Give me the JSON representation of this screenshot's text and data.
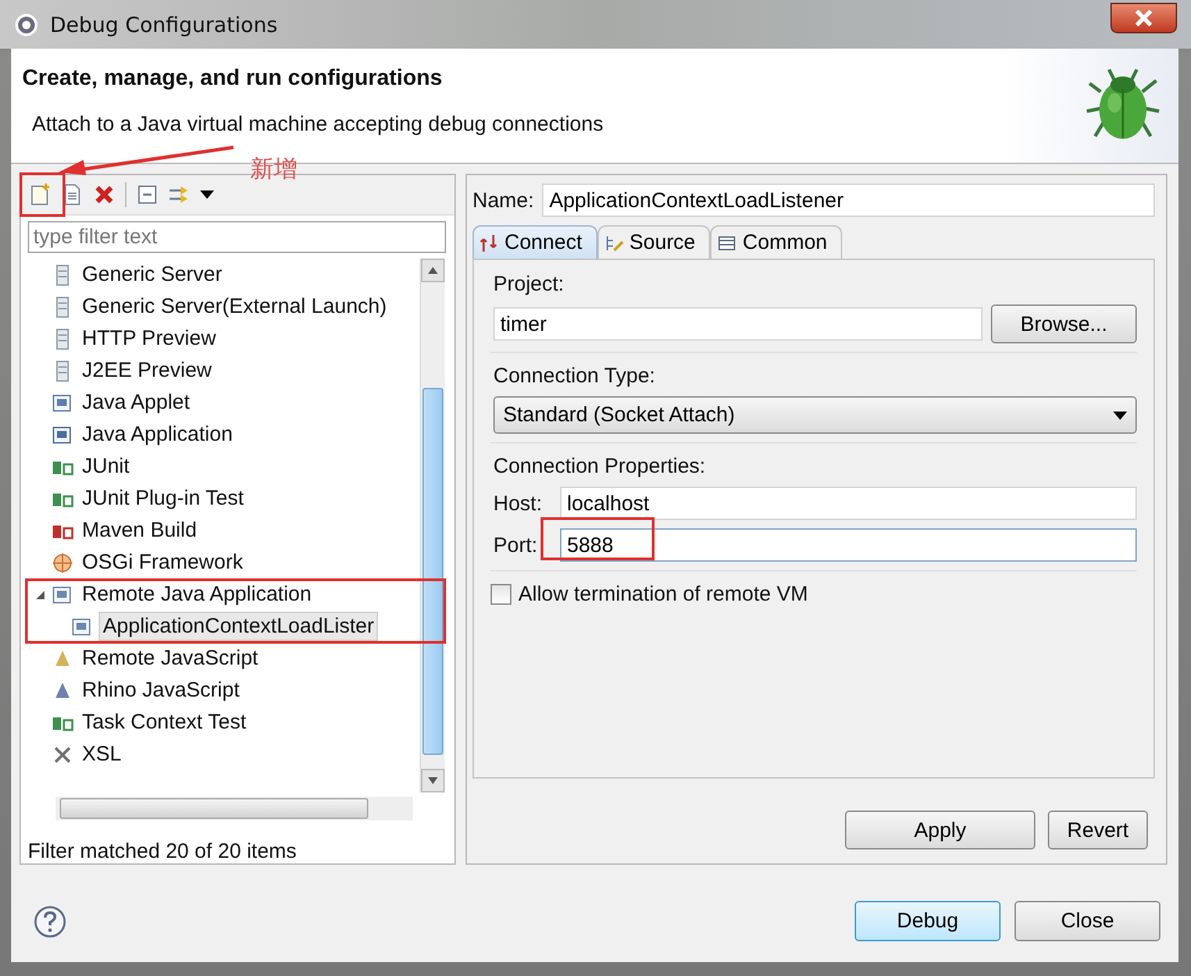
{
  "window": {
    "title": "Debug Configurations"
  },
  "header": {
    "title": "Create, manage, and run configurations",
    "message": "Attach to a Java virtual machine accepting debug connections"
  },
  "annotation": {
    "label": "新增"
  },
  "filter": {
    "placeholder": "type filter text"
  },
  "tree": [
    {
      "label": "Generic Server",
      "kind": "server",
      "selected": false
    },
    {
      "label": "Generic Server(External Launch)",
      "kind": "server",
      "selected": false
    },
    {
      "label": "HTTP Preview",
      "kind": "server",
      "selected": false
    },
    {
      "label": "J2EE Preview",
      "kind": "server",
      "selected": false
    },
    {
      "label": "Java Applet",
      "kind": "applet",
      "selected": false
    },
    {
      "label": "Java Application",
      "kind": "application",
      "selected": false
    },
    {
      "label": "JUnit",
      "kind": "junit",
      "selected": false
    },
    {
      "label": "JUnit Plug-in Test",
      "kind": "junit",
      "selected": false
    },
    {
      "label": "Maven Build",
      "kind": "maven",
      "selected": false
    },
    {
      "label": "OSGi Framework",
      "kind": "osgi",
      "selected": false
    },
    {
      "label": "Remote Java Application",
      "kind": "remote",
      "selected": false,
      "expanded": true,
      "children": [
        {
          "label": "ApplicationContextLoadLister",
          "kind": "remote",
          "selected": true
        }
      ]
    },
    {
      "label": "Remote JavaScript",
      "kind": "script",
      "selected": false
    },
    {
      "label": "Rhino JavaScript",
      "kind": "rhino",
      "selected": false
    },
    {
      "label": "Task Context Test",
      "kind": "junit",
      "selected": false
    },
    {
      "label": "XSL",
      "kind": "xsl",
      "selected": false
    }
  ],
  "filter_status": "Filter matched 20 of 20 items",
  "name_field": {
    "label": "Name:",
    "value": "ApplicationContextLoadListener"
  },
  "tabs": [
    {
      "label": "Connect",
      "selected": true
    },
    {
      "label": "Source",
      "selected": false
    },
    {
      "label": "Common",
      "selected": false
    }
  ],
  "project": {
    "label": "Project:",
    "value": "timer",
    "button": "Browse..."
  },
  "connection_type": {
    "label": "Connection Type:",
    "value": "Standard (Socket Attach)"
  },
  "connection_properties": {
    "label": "Connection Properties:",
    "host_label": "Host:",
    "host": "localhost",
    "port_label": "Port:",
    "port": "5888"
  },
  "allow_termination": {
    "label": "Allow termination of remote VM",
    "checked": false
  },
  "actions": [
    "Apply",
    "Revert"
  ],
  "buttons": [
    {
      "label": "Debug",
      "default": true
    },
    {
      "label": "Close",
      "default": false
    }
  ]
}
